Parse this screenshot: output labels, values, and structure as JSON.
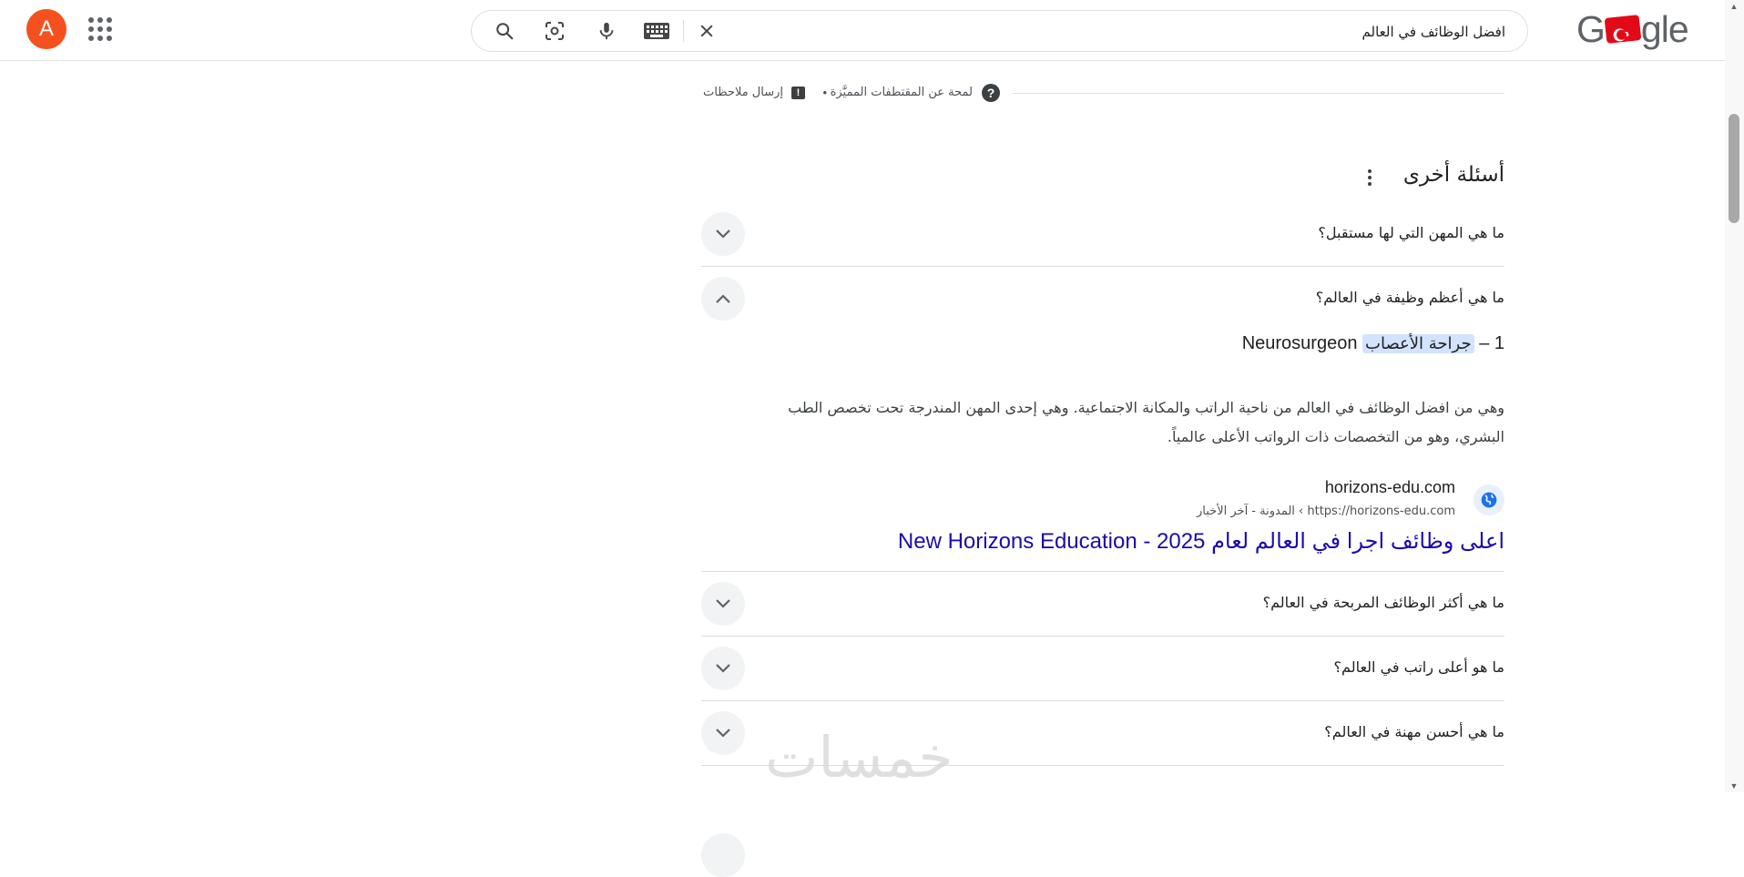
{
  "header": {
    "avatar_letter": "A",
    "apps_icon": "apps-grid-icon",
    "search": {
      "value": "افضل الوظائف في العالم",
      "icons": [
        "search-icon",
        "lens-icon",
        "mic-icon",
        "keyboard-icon",
        "clear-icon"
      ]
    },
    "logo": {
      "left": "G",
      "right": "gle",
      "flag_icon": "turkish-flag-icon"
    }
  },
  "featured_snippet_bar": {
    "about_label": "لمحة عن المقتطفات المميَّزة",
    "feedback_label": "إرسال ملاحظات",
    "help_icon_text": "?",
    "feedback_icon_text": "!",
    "separator": "•"
  },
  "people_also_ask": {
    "title": "أسئلة أخرى",
    "questions": [
      {
        "text": "ما هي المهن التي لها مستقبل؟",
        "expanded": false
      },
      {
        "text": "ما هي أعظم وظيفة في العالم؟",
        "expanded": true
      },
      {
        "text": "ما هي أكثر الوظائف المربحة في العالم؟",
        "expanded": false
      },
      {
        "text": "ما هو أعلى راتب في العالم؟",
        "expanded": false
      },
      {
        "text": "ما هي أحسن مهنة في العالم؟",
        "expanded": false
      }
    ],
    "answer": {
      "prefix": "1 –",
      "highlight": "جراحة الأعصاب",
      "suffix": "Neurosurgeon",
      "body": "وهي من افضل الوظائف في العالم من ناحية الراتب والمكانة الاجتماعية. وهي إحدى المهن المندرجة تحت تخصص الطب البشري، وهو من التخصصات ذات الرواتب الأعلى عالمياً.",
      "source_site": "horizons-edu.com",
      "source_url": "https://horizons-edu.com › المدونة - آخر الأخبار",
      "source_title": "اعلى وظائف اجرا في العالم لعام 2025 - New Horizons Education"
    }
  },
  "watermark": "خمسات",
  "colors": {
    "avatar": "#f4511e",
    "link": "#1a0dab",
    "highlight": "#d3e3fd",
    "flag": "#e30a17"
  }
}
